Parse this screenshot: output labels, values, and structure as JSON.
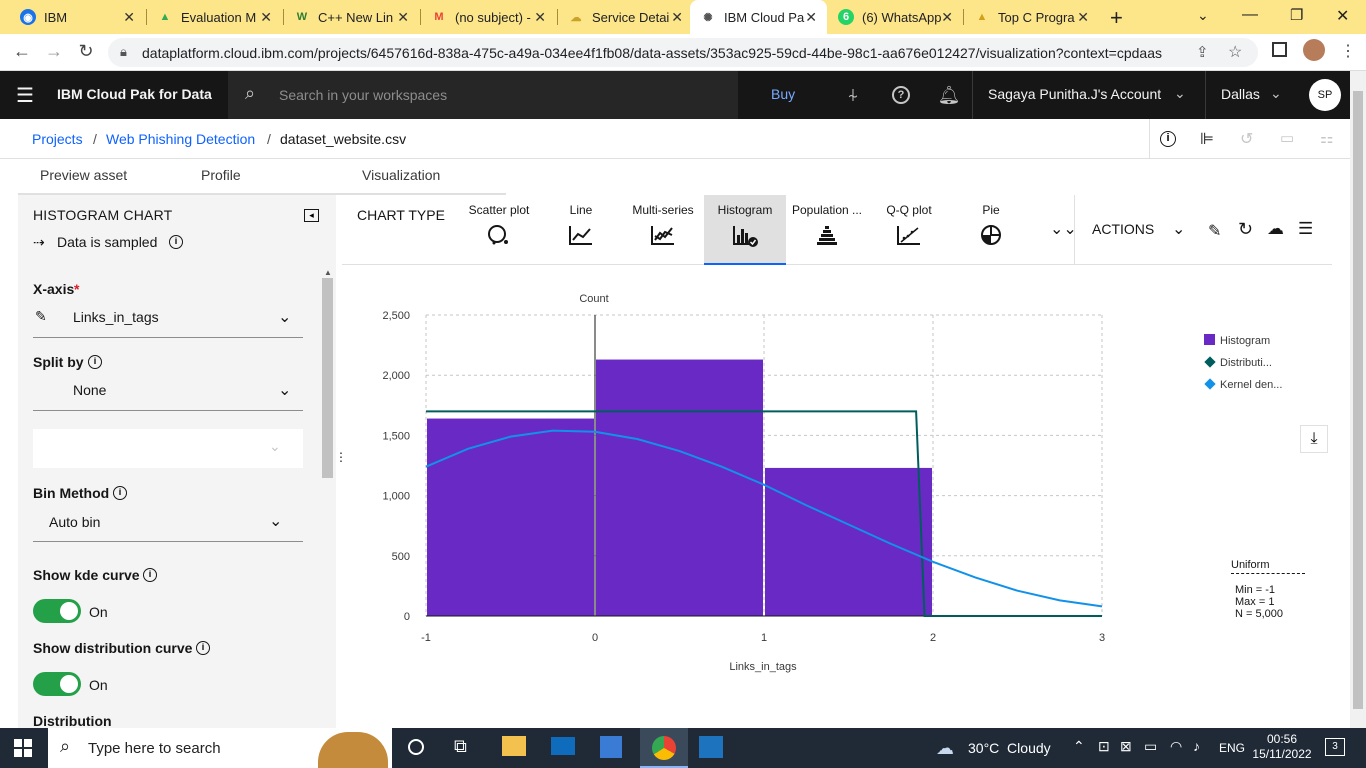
{
  "browser": {
    "tabs": [
      {
        "title": "IBM",
        "icon_color": "#1a73e8"
      },
      {
        "title": "Evaluation M",
        "icon_color": "#34a853"
      },
      {
        "title": "C++ New Lin",
        "icon_color": "#2e7d32"
      },
      {
        "title": "(no subject) -",
        "icon_color": "#ea4335"
      },
      {
        "title": "Service Detai",
        "icon_color": "#c9a227"
      },
      {
        "title": "IBM Cloud Pa",
        "icon_color": "#555555"
      },
      {
        "title": "(6) WhatsApp",
        "icon_color": "#25d366"
      },
      {
        "title": "Top C Progra",
        "icon_color": "#d4a017"
      }
    ],
    "url": "dataplatform.cloud.ibm.com/projects/6457616d-838a-475c-a49a-034ee4f1fb08/data-assets/353ac925-59cd-44be-98c1-aa676e012427/visualization?context=cpdaas"
  },
  "header": {
    "app_name": "IBM Cloud Pak for Data",
    "search_placeholder": "Search in your workspaces",
    "buy_label": "Buy",
    "account": "Sagaya Punitha.J's Account",
    "region": "Dallas",
    "avatar": "SP"
  },
  "breadcrumb": {
    "projects": "Projects",
    "project": "Web Phishing Detection",
    "asset": "dataset_website.csv"
  },
  "subtabs": [
    "Preview asset",
    "Profile",
    "Visualization"
  ],
  "left_panel": {
    "title": "HISTOGRAM CHART",
    "sampled": "Data is sampled",
    "xaxis_label": "X-axis",
    "xaxis_required": "*",
    "xaxis_value": "Links_in_tags",
    "split_label": "Split by",
    "split_value": "None",
    "bin_label": "Bin Method",
    "bin_value": "Auto bin",
    "kde_label": "Show kde curve",
    "kde_state": "On",
    "dist_label": "Show distribution curve",
    "dist_state": "On",
    "distribution_label": "Distribution"
  },
  "chart_toolbar": {
    "chart_type_label": "CHART TYPE",
    "types": [
      "Scatter plot",
      "Line",
      "Multi-series",
      "Histogram",
      "Population ...",
      "Q-Q plot",
      "Pie"
    ],
    "selected": "Histogram",
    "actions_label": "ACTIONS"
  },
  "chart_data": {
    "type": "bar",
    "ylabel": "Count",
    "xlabel": "Links_in_tags",
    "x_ticks": [
      "-1",
      "0",
      "1",
      "2",
      "3"
    ],
    "y_ticks": [
      "0",
      "500",
      "1,000",
      "1,500",
      "2,000",
      "2,500"
    ],
    "xlim": [
      -1,
      3
    ],
    "ylim": [
      0,
      2500
    ],
    "bins": [
      {
        "x0": -1,
        "x1": 0,
        "count": 1640
      },
      {
        "x0": 0,
        "x1": 1,
        "count": 2130
      },
      {
        "x0": 1,
        "x1": 2,
        "count": 1230
      }
    ],
    "distribution_curve": {
      "x": [
        -1,
        1.9,
        1.95,
        3
      ],
      "y": [
        1700,
        1700,
        0,
        0
      ]
    },
    "kde_curve": {
      "x": [
        -1,
        -0.75,
        -0.5,
        -0.25,
        0,
        0.25,
        0.5,
        0.75,
        1,
        1.25,
        1.5,
        1.75,
        2,
        2.25,
        2.5,
        2.75,
        3
      ],
      "y": [
        1240,
        1390,
        1490,
        1540,
        1530,
        1470,
        1370,
        1240,
        1090,
        920,
        760,
        600,
        450,
        320,
        210,
        130,
        80
      ]
    },
    "legend": [
      {
        "name": "Histogram",
        "color": "#6929c4"
      },
      {
        "name": "Distributi...",
        "color": "#005d5d"
      },
      {
        "name": "Kernel den...",
        "color": "#1192e8"
      }
    ],
    "stats": {
      "title": "Uniform",
      "lines": [
        "Min = -1",
        "Max = 1",
        "N = 5,000"
      ]
    },
    "grid": true
  },
  "taskbar": {
    "search_placeholder": "Type here to search",
    "weather": "30°C  Cloudy",
    "lang": "ENG",
    "time": "00:56",
    "date": "15/11/2022",
    "notif_count": "3"
  }
}
